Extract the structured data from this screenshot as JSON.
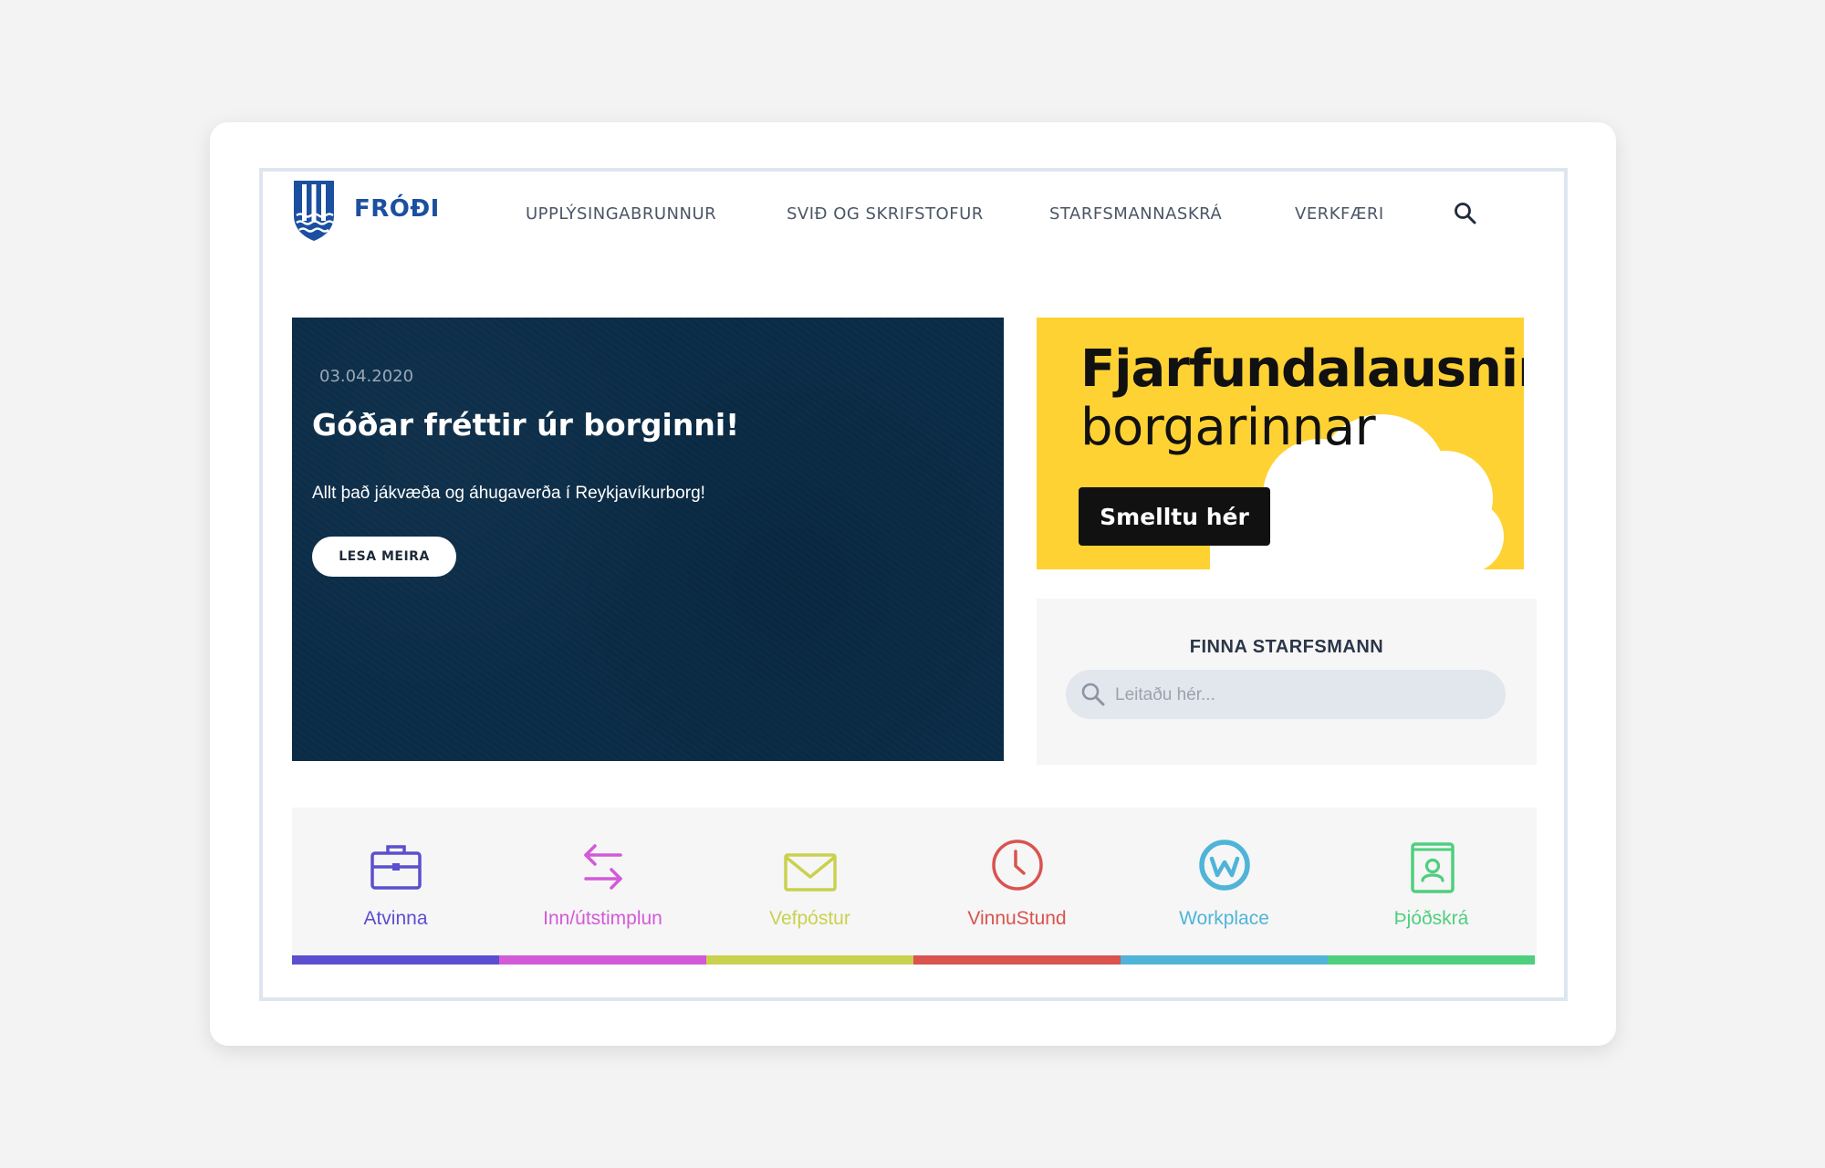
{
  "header": {
    "brand": "FRÓÐI",
    "nav": [
      "UPPLÝSINGABRUNNUR",
      "SVIÐ OG SKRIFSTOFUR",
      "STARFSMANNASKRÁ",
      "VERKFÆRI"
    ]
  },
  "hero": {
    "date": "03.04.2020",
    "title": "Góðar fréttir úr borginni!",
    "text": "Allt það jákvæða og áhugaverða í Reykjavíkurborg!",
    "button": "LESA MEIRA"
  },
  "promo": {
    "line1": "Fjarfundalausnir",
    "line2": "borgarinnar",
    "button": "Smelltu hér"
  },
  "finder": {
    "title": "FINNA STARFSMANN",
    "placeholder": "Leitaðu hér..."
  },
  "links": [
    {
      "label": "Atvinna",
      "icon": "briefcase-icon",
      "color": "#5b4fd0"
    },
    {
      "label": "Inn/útstimplun",
      "icon": "swap-arrows-icon",
      "color": "#d25ad8"
    },
    {
      "label": "Vefpóstur",
      "icon": "envelope-icon",
      "color": "#c9d14e"
    },
    {
      "label": "VinnuStund",
      "icon": "clock-icon",
      "color": "#d9534f"
    },
    {
      "label": "Workplace",
      "icon": "workplace-icon",
      "color": "#4fb4d8"
    },
    {
      "label": "Þjóðskrá",
      "icon": "contact-book-icon",
      "color": "#4fcf7e"
    }
  ],
  "colors": {
    "brand": "#1b4fa0",
    "hero_bg": "#0a2c47",
    "promo_bg": "#ffd234"
  }
}
